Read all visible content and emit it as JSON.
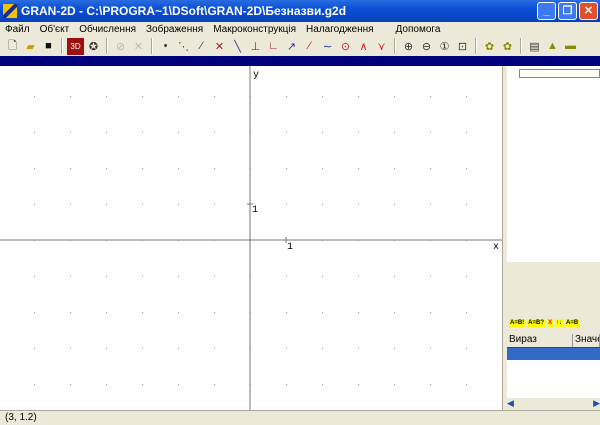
{
  "window": {
    "title": "GRAN-2D  -  C:\\PROGRA~1\\DSoft\\GRAN-2D\\Безназви.g2d",
    "minimize": "_",
    "maximize": "❐",
    "close": "✕"
  },
  "menu": [
    "Файл",
    "Об'єкт",
    "Обчислення",
    "Зображення",
    "Макроконструкція",
    "Налагодження",
    "Допомога"
  ],
  "toolbar": {
    "file": [
      "new-file",
      "open-folder",
      "save"
    ],
    "ops": [
      "calculator-3d",
      "refresh"
    ],
    "disabled": [
      "undo",
      "delete"
    ],
    "construct": [
      "point",
      "segment-points",
      "line",
      "intersection",
      "segment",
      "perpendicular",
      "angle",
      "vector",
      "arc",
      "polyline",
      "circle",
      "curve",
      "broken-line"
    ],
    "zoom": [
      "zoom-in",
      "zoom-out",
      "zoom-reset",
      "zoom-window"
    ],
    "macros": [
      "macro-record",
      "macro-play"
    ],
    "calc": [
      "calculator",
      "measure",
      "ruler"
    ]
  },
  "canvas": {
    "x_axis_label": "x",
    "y_axis_label": "y",
    "x_unit_label": "1",
    "y_unit_label": "1"
  },
  "panel": {
    "columns": [
      "Вираз",
      "Значен"
    ],
    "tools": [
      "A=B!",
      "A=B?",
      "X",
      "↑↓",
      "A=B"
    ]
  },
  "status": {
    "coords": "(3, 1.2)"
  }
}
